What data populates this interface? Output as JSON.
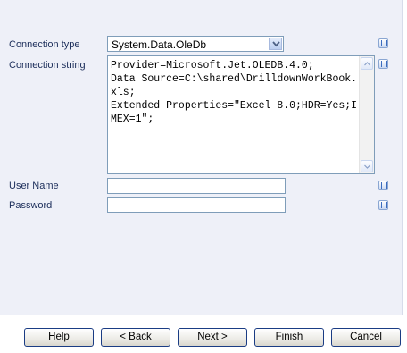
{
  "form": {
    "connection_type_label": "Connection type",
    "connection_type_value": "System.Data.OleDb",
    "connection_string_label": "Connection string",
    "connection_string_value": "Provider=Microsoft.Jet.OLEDB.4.0;\nData Source=C:\\shared\\DrilldownWorkBook.xls;\nExtended Properties=\"Excel 8.0;HDR=Yes;IMEX=1\";",
    "user_name_label": "User Name",
    "user_name_value": "",
    "password_label": "Password",
    "password_value": ""
  },
  "buttons": {
    "help": "Help",
    "back": "< Back",
    "next": "Next >",
    "finish": "Finish",
    "cancel": "Cancel"
  },
  "icons": {
    "info": "info-icon",
    "dropdown": "chevron-down-icon",
    "scroll_up": "scroll-up-arrow-icon",
    "scroll_down": "scroll-down-arrow-icon"
  },
  "colors": {
    "panel_bg": "#eef0f8",
    "label_text": "#1b2d5a",
    "button_border": "#1a3c84"
  }
}
